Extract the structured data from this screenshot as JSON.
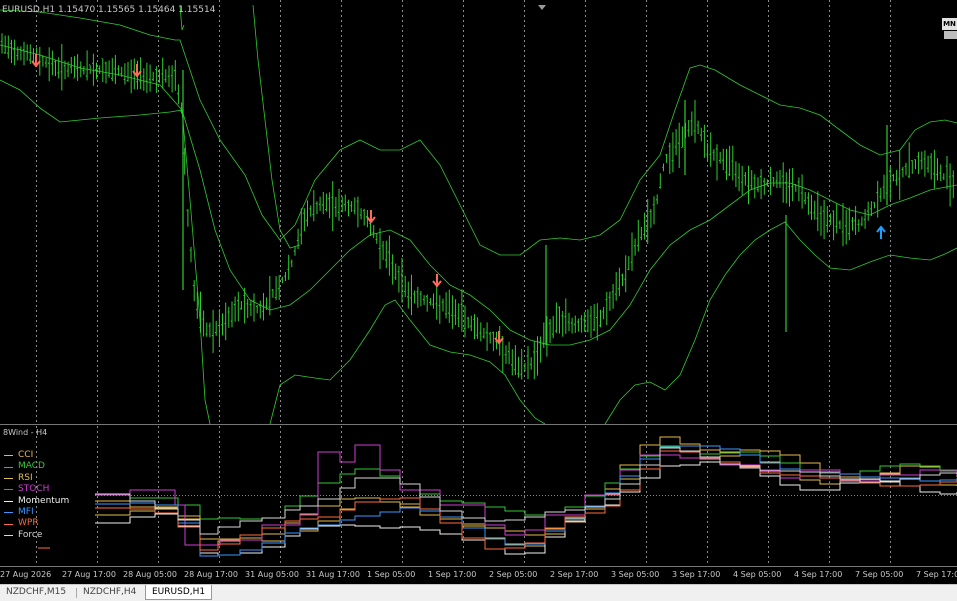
{
  "symbol_label": "EURUSD,H1  1.15470 1.15565 1.15464 1.15514",
  "mn_button": "MN",
  "subwindow_title": "8Wind - H4",
  "legend": [
    {
      "label": "CCI",
      "color": "#e8b84a"
    },
    {
      "label": "MACD",
      "color": "#34c934"
    },
    {
      "label": "RSI",
      "color": "#e0c050"
    },
    {
      "label": "STOCH",
      "color": "#d23cd2"
    },
    {
      "label": "Momentum",
      "color": "#f0f0f0"
    },
    {
      "label": "MFI",
      "color": "#3c96ff"
    },
    {
      "label": "WPR",
      "color": "#ff6a3c"
    },
    {
      "label": "Force",
      "color": "#d8d8d8"
    }
  ],
  "time_axis": [
    "27 Aug 2026",
    "27 Aug 17:00",
    "28 Aug 05:00",
    "28 Aug 17:00",
    "31 Aug 05:00",
    "31 Aug 17:00",
    "1 Sep 05:00",
    "1 Sep 17:00",
    "2 Sep 05:00",
    "2 Sep 17:00",
    "3 Sep 05:00",
    "3 Sep 17:00",
    "4 Sep 05:00",
    "4 Sep 17:00",
    "7 Sep 05:00",
    "7 Sep 17:00"
  ],
  "tabs": [
    {
      "label": "NZDCHF,M15",
      "active": false
    },
    {
      "label": "NZDCHF,H4",
      "active": false
    },
    {
      "label": "EURUSD,H1",
      "active": true
    }
  ],
  "signals": [
    {
      "type": "sell",
      "color": "#ff6a5a"
    },
    {
      "type": "sell",
      "color": "#ff6a5a"
    },
    {
      "type": "sell",
      "color": "#ff6a5a"
    },
    {
      "type": "sell",
      "color": "#ff6a5a"
    },
    {
      "type": "sell",
      "color": "#ff6a5a"
    },
    {
      "type": "buy",
      "color": "#1ea0ff"
    }
  ],
  "colors": {
    "candle": "#2ecc2e",
    "band": "#2ecc2e",
    "grid": "#8a8a8a",
    "background": "#000000"
  }
}
